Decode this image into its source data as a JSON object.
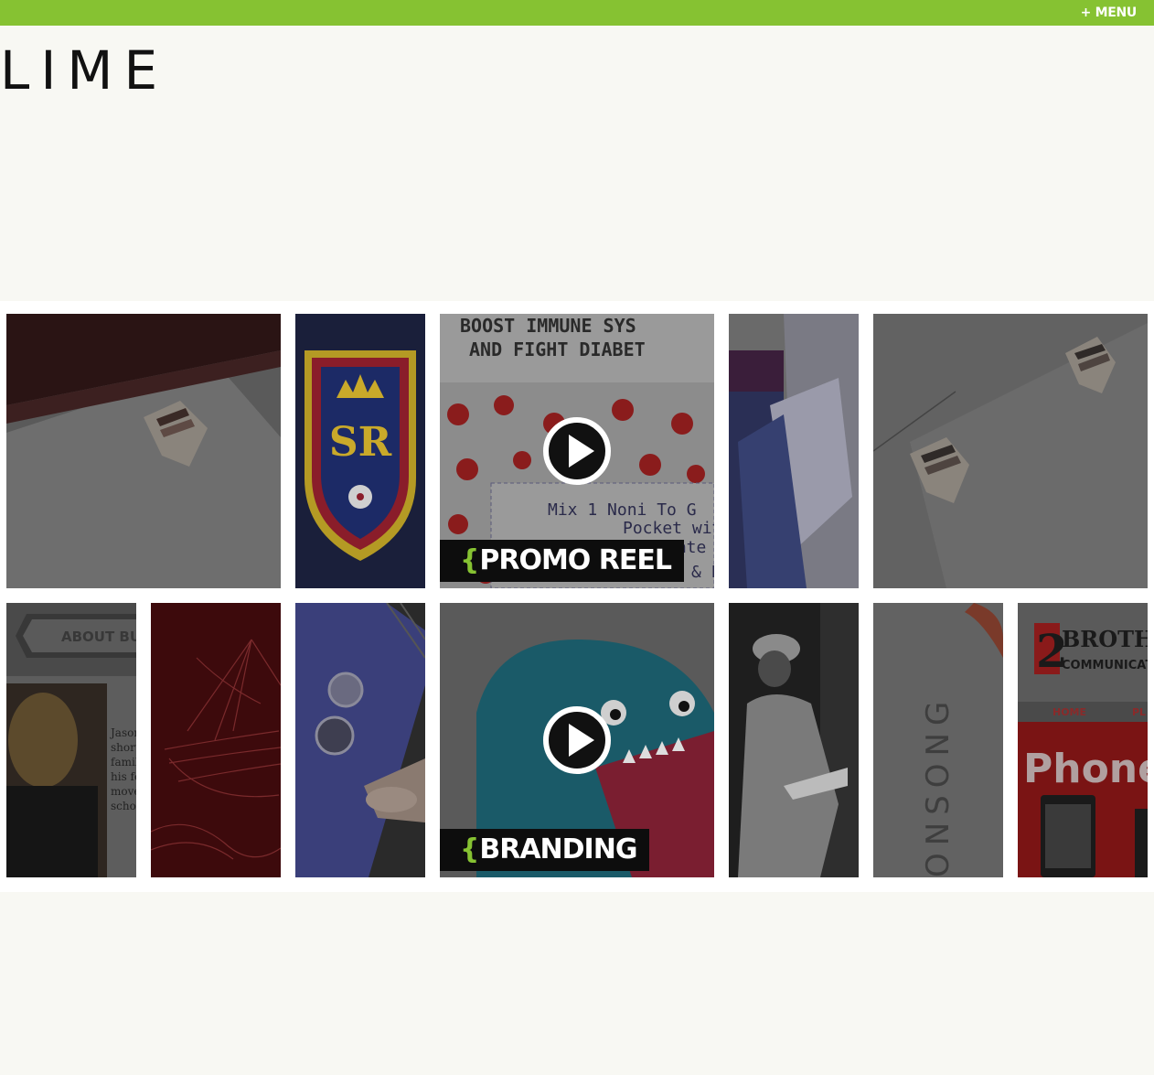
{
  "header": {
    "menu_label": "+ MENU",
    "logo_text": "LIME"
  },
  "colors": {
    "accent": "#86c232",
    "background": "#f8f8f3",
    "tile_overlay": "#2b2b2b"
  },
  "tiles": {
    "promo_reel": {
      "caption": "PROMO REEL",
      "brace": "{",
      "card_line1": "BOOST IMMUNE SYS",
      "card_line2": "AND FIGHT DIABET",
      "card_line3": "Mix 1 Noni To G",
      "card_line4": "Pocket with",
      "card_line5": "Drink & Enjo",
      "card_line6": "Wate"
    },
    "branding": {
      "caption": "BRANDING",
      "brace": "{"
    },
    "about": {
      "banner": "ABOUT BUCK",
      "text_lines": [
        "Jason",
        "short",
        "famil",
        "his fe",
        "move",
        "schoo"
      ]
    },
    "onsong": {
      "text": "ONSONG"
    },
    "two_brothers": {
      "number": "2",
      "name": "BROTH",
      "sub": "COMMUNICAT",
      "nav_home": "HOME",
      "nav_pl": "PL",
      "headline": "Phone"
    },
    "rsl_badge": {
      "letters": "SR"
    }
  }
}
